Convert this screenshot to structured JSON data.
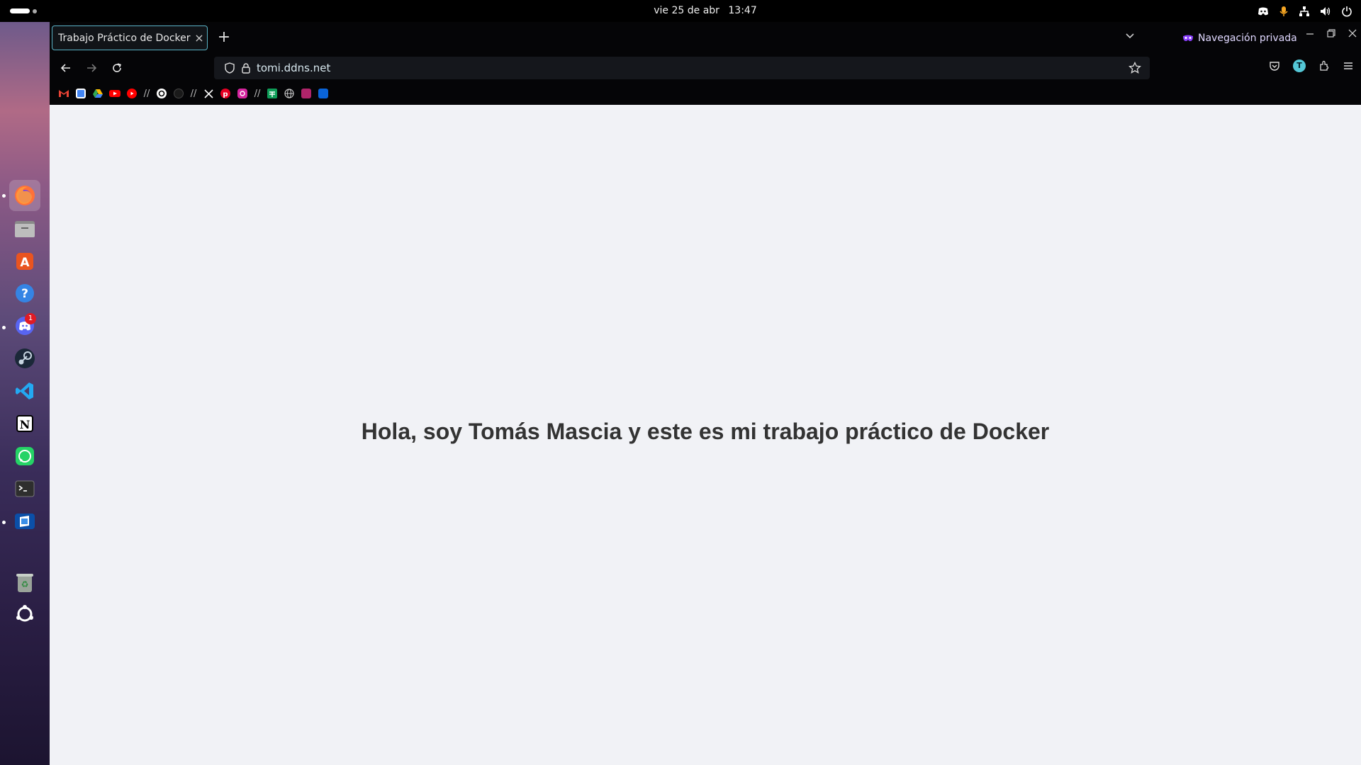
{
  "topbar": {
    "date": "vie 25 de abr",
    "time": "13:47",
    "tray_icons": [
      "discord-tray-icon",
      "microphone-icon",
      "network-icon",
      "volume-icon",
      "power-icon"
    ]
  },
  "dock": {
    "apps": [
      "firefox",
      "files",
      "app-center",
      "help",
      "discord",
      "steam",
      "vscode",
      "notion",
      "whatsapp",
      "terminal",
      "remote-desktop",
      "trash",
      "ubuntu-apps"
    ],
    "discord_badge": "1"
  },
  "browser": {
    "tab_title": "Trabajo Práctico de Docker",
    "tab_close": "×",
    "new_tab": "+",
    "private_label": "Navegación privada",
    "url": "tomi.ddns.net",
    "profile_initial": "T",
    "bookmark_separator": "//"
  },
  "page": {
    "heading": "Hola, soy Tomás Mascia y este es mi trabajo práctico de Docker"
  },
  "colors": {
    "tab_border": "#5ab3c6",
    "private_purple": "#8a3ffc",
    "page_bg": "#f1f2f6",
    "heading": "#333333"
  }
}
